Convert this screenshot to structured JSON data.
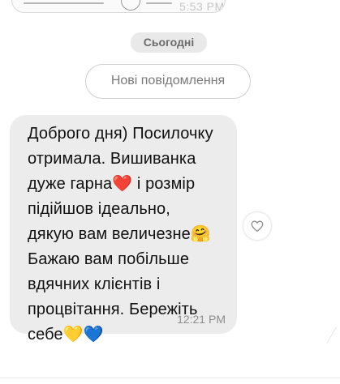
{
  "previous_message": {
    "time": "5:53 PM"
  },
  "date_separator": "Сьогодні",
  "new_messages_label": "Нові повідомлення",
  "message": {
    "text": "Доброго дня) Посилочку\nотримала. Вишиванка\nдуже гарна❤️ і розмір\nпідійшов ідеально,\nдякую вам величезне🤗\nБажаю вам побільше\nвдячних клієнтів і\nпроцвітання. Бережіть\nсебе💛💙",
    "time": "12:21 PM"
  },
  "icons": {
    "like": "heart-outline-icon"
  }
}
